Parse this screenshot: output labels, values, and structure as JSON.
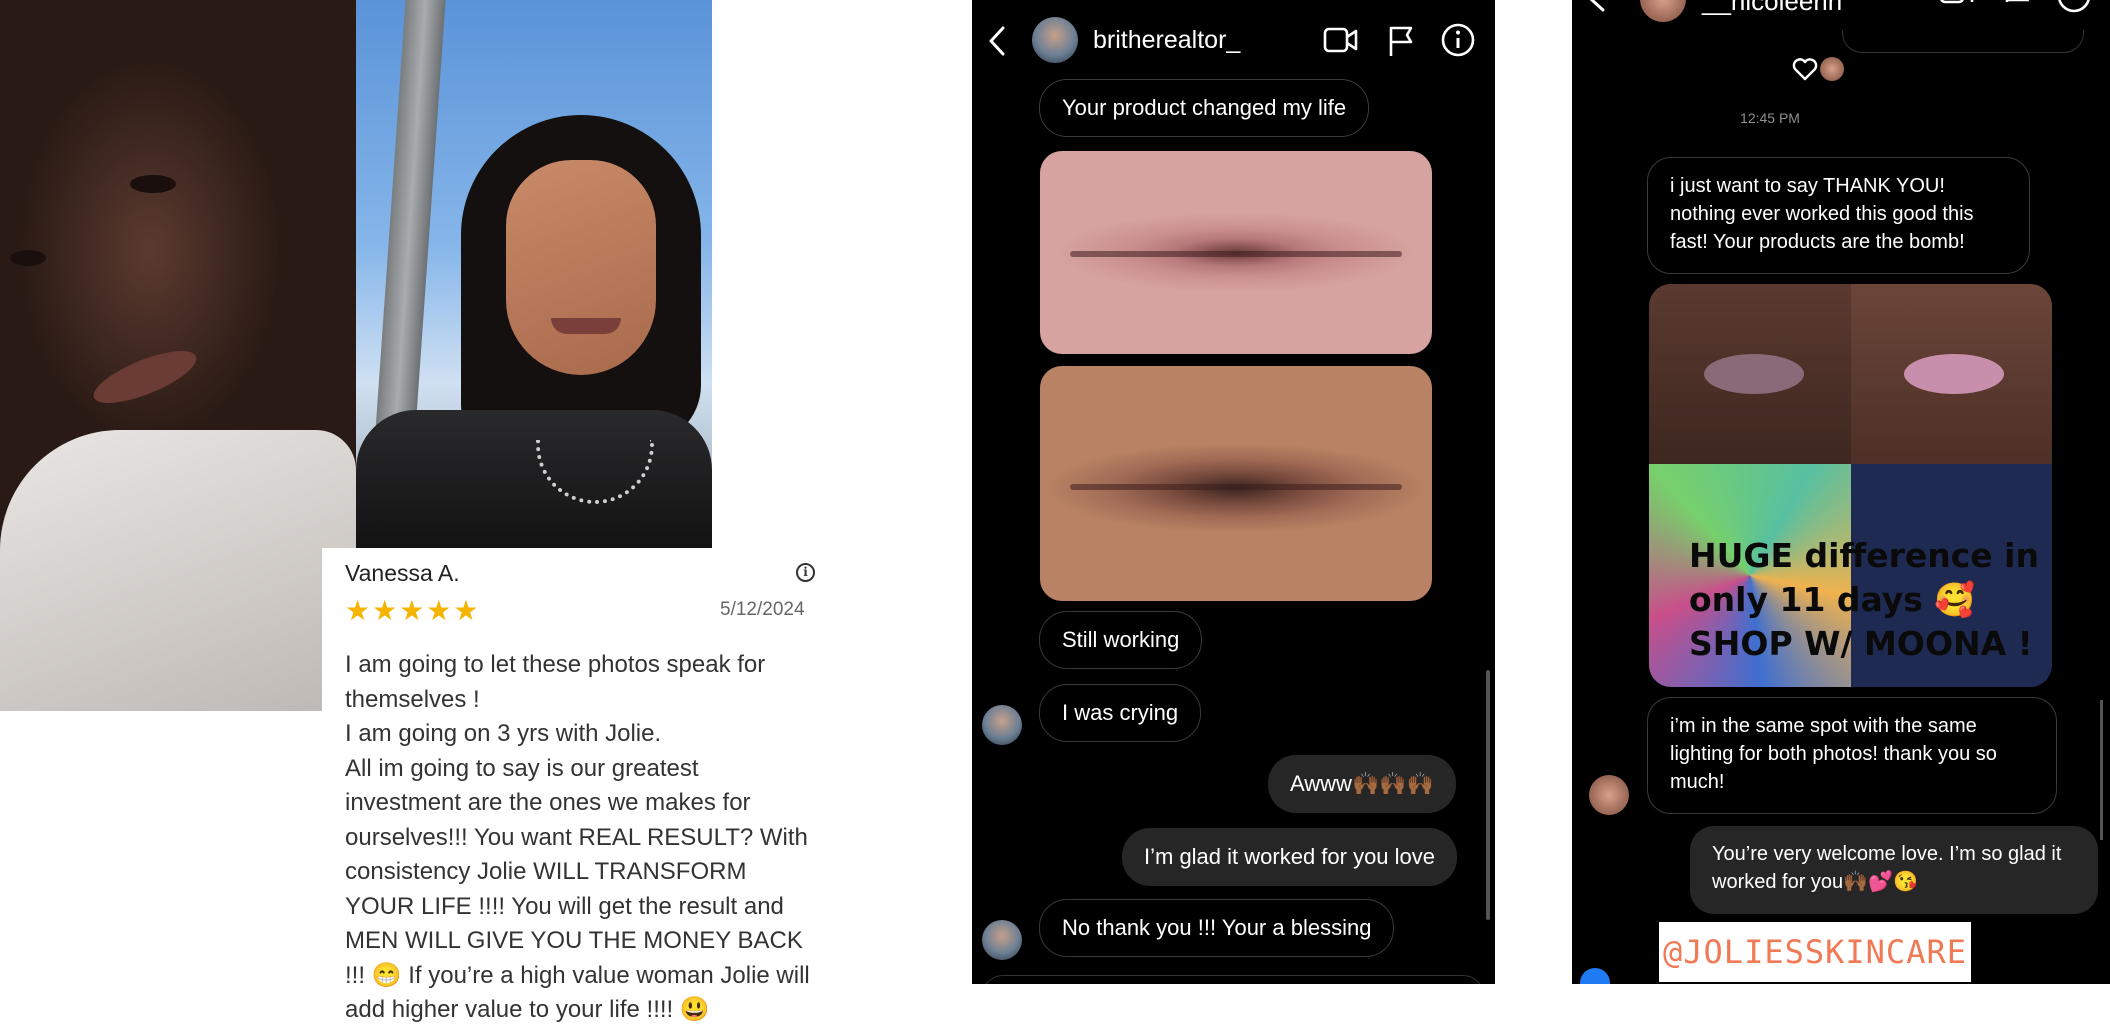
{
  "review": {
    "name": "Vanessa A.",
    "stars": "★★★★★",
    "rating": 5,
    "date": "5/12/2024",
    "body": "I am going to let these photos speak for themselves !\nI am going on 3 yrs with Jolie.\nAll im going to say is our greatest investment are the ones we makes for ourselves!!! You want REAL RESULT? With consistency Jolie WILL TRANSFORM YOUR LIFE !!!! You will get the result and MEN WILL GIVE YOU THE MONEY BACK !!! 😁 If you’re a high value woman Jolie will add higher value to your life !!!! 😃"
  },
  "dm_middle": {
    "username": "britherealtor_",
    "messages": [
      {
        "text": "Your product changed my life",
        "from": "them"
      },
      {
        "text": "Still working",
        "from": "them"
      },
      {
        "text": "I was crying",
        "from": "them"
      },
      {
        "text": "Awww🙌🏾🙌🏾🙌🏾",
        "from": "me"
      },
      {
        "text": "I’m glad it worked for you love",
        "from": "me"
      },
      {
        "text": "No thank you !!! Your a blessing",
        "from": "them"
      }
    ],
    "icons": [
      "back-icon",
      "video-call-icon",
      "flag-icon",
      "info-icon"
    ]
  },
  "dm_right": {
    "username": "__nicoleerin",
    "timestamp": "12:45 PM",
    "messages": [
      {
        "text": "i just want to say THANK YOU! nothing ever worked this good this fast! Your products are the bomb!",
        "from": "them"
      },
      {
        "text": "i’m in the same spot with the same lighting for both photos! thank you so much!",
        "from": "them"
      },
      {
        "text": "You’re very welcome love. I’m so glad it worked for you🙌🏾💕😘",
        "from": "me"
      }
    ],
    "photo_caption": "HUGE difference in\nonly 11 days 🥰\nSHOP W/ MOONA !",
    "reaction_icon": "heart-icon"
  },
  "sticker": "@JOLIESSKINCARE"
}
